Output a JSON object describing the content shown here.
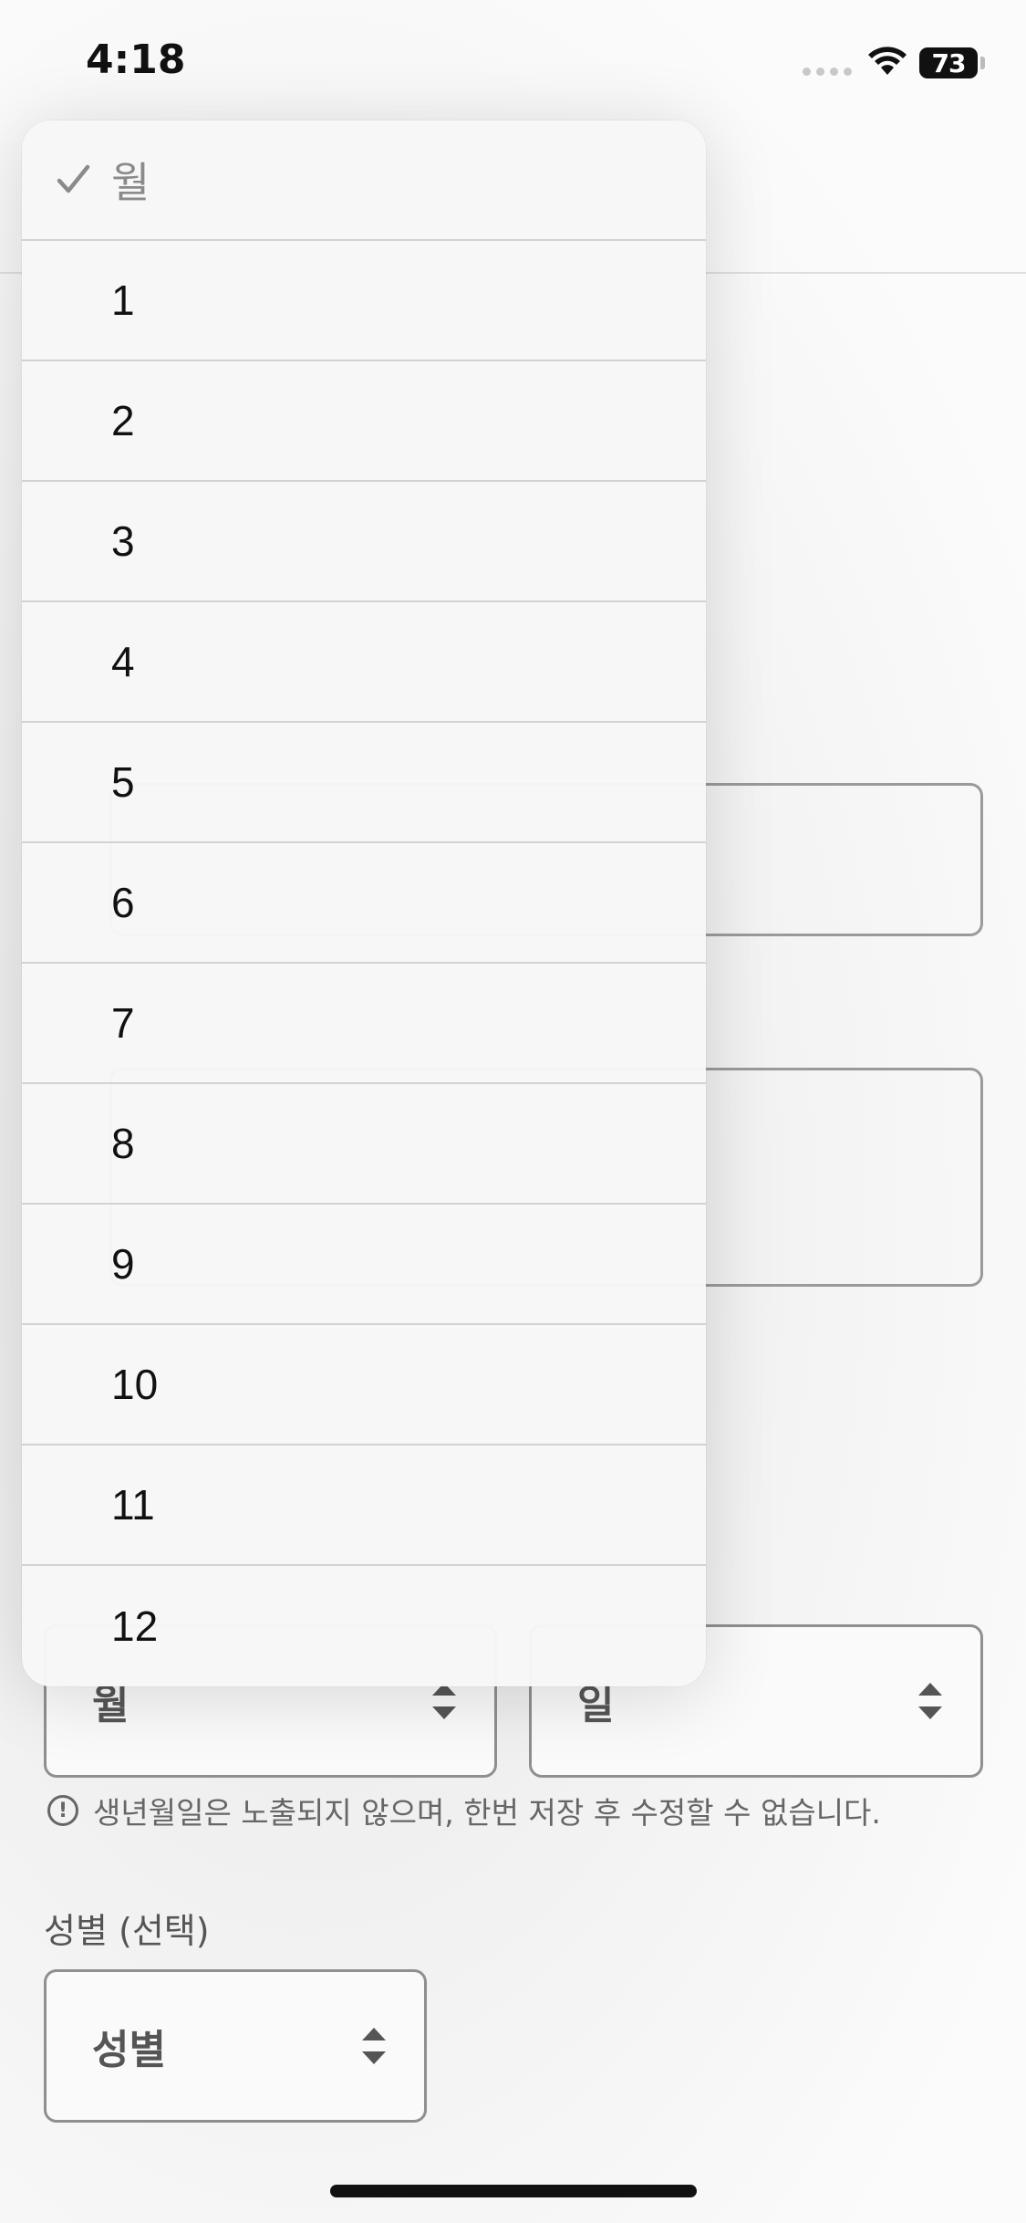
{
  "status_bar": {
    "time": "4:18",
    "battery": "73"
  },
  "menu": {
    "selected_label": "월",
    "items": [
      "1",
      "2",
      "3",
      "4",
      "5",
      "6",
      "7",
      "8",
      "9",
      "10",
      "11",
      "12"
    ]
  },
  "birth": {
    "month_placeholder": "월",
    "day_placeholder": "일",
    "notice": "생년월일은 노출되지 않으며, 한번 저장 후 수정할 수 없습니다."
  },
  "gender": {
    "label": "성별 (선택)",
    "placeholder": "성별"
  }
}
